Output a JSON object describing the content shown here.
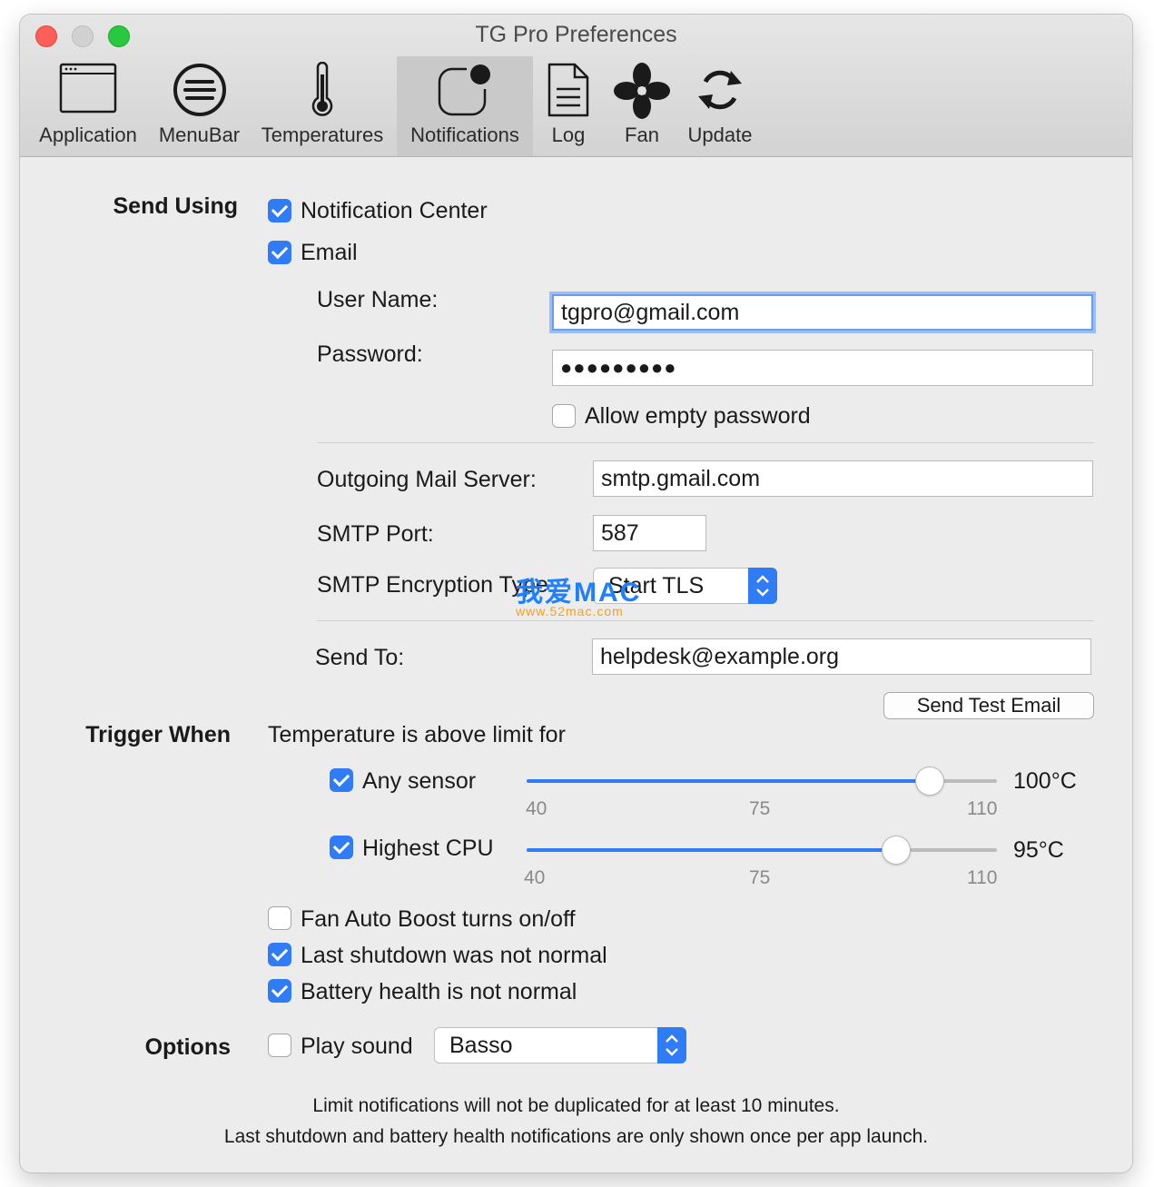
{
  "window": {
    "title": "TG Pro Preferences"
  },
  "toolbar": {
    "tabs": [
      {
        "label": "Application",
        "icon": "application-window-icon"
      },
      {
        "label": "MenuBar",
        "icon": "menubar-list-icon"
      },
      {
        "label": "Temperatures",
        "icon": "thermometer-icon"
      },
      {
        "label": "Notifications",
        "icon": "notification-badge-icon",
        "selected": true
      },
      {
        "label": "Log",
        "icon": "document-log-icon"
      },
      {
        "label": "Fan",
        "icon": "fan-icon"
      },
      {
        "label": "Update",
        "icon": "refresh-arrows-icon"
      }
    ]
  },
  "send_using": {
    "section_label": "Send Using",
    "notification_center": {
      "label": "Notification Center",
      "checked": true
    },
    "email": {
      "label": "Email",
      "checked": true
    },
    "username": {
      "label": "User Name:",
      "value": "tgpro@gmail.com"
    },
    "password": {
      "label": "Password:",
      "value": "●●●●●●●●●"
    },
    "allow_empty": {
      "label": "Allow empty password",
      "checked": false
    },
    "server": {
      "label": "Outgoing Mail Server:",
      "value": "smtp.gmail.com"
    },
    "port": {
      "label": "SMTP Port:",
      "value": "587"
    },
    "encryption": {
      "label": "SMTP Encryption Type:",
      "value": "Start TLS"
    },
    "send_to": {
      "label": "Send To:",
      "value": "helpdesk@example.org"
    },
    "test_button": "Send Test Email"
  },
  "trigger": {
    "section_label": "Trigger When",
    "heading": "Temperature is above limit for",
    "sliders": [
      {
        "label": "Any sensor",
        "checked": true,
        "min": 40,
        "max": 110,
        "value": 100,
        "value_label": "100°C",
        "ticks": [
          "40",
          "75",
          "110"
        ]
      },
      {
        "label": "Highest CPU",
        "checked": true,
        "min": 40,
        "max": 110,
        "value": 95,
        "value_label": "95°C",
        "ticks": [
          "40",
          "75",
          "110"
        ]
      }
    ],
    "fan_boost": {
      "label": "Fan Auto Boost turns on/off",
      "checked": false
    },
    "last_shutdown": {
      "label": "Last shutdown was not normal",
      "checked": true
    },
    "battery": {
      "label": "Battery health is not normal",
      "checked": true
    }
  },
  "options": {
    "section_label": "Options",
    "play_sound": {
      "label": "Play sound",
      "checked": false
    },
    "sound": "Basso"
  },
  "footer": {
    "line1": "Limit notifications will not be duplicated for at least 10 minutes.",
    "line2": "Last shutdown and battery health notifications are only shown once per app launch."
  },
  "watermark": {
    "text": "我爱MAC",
    "url": "www.52mac.com"
  },
  "colors": {
    "accent": "#2f7cf6",
    "close": "#fe5f57",
    "zoom": "#28c840"
  }
}
